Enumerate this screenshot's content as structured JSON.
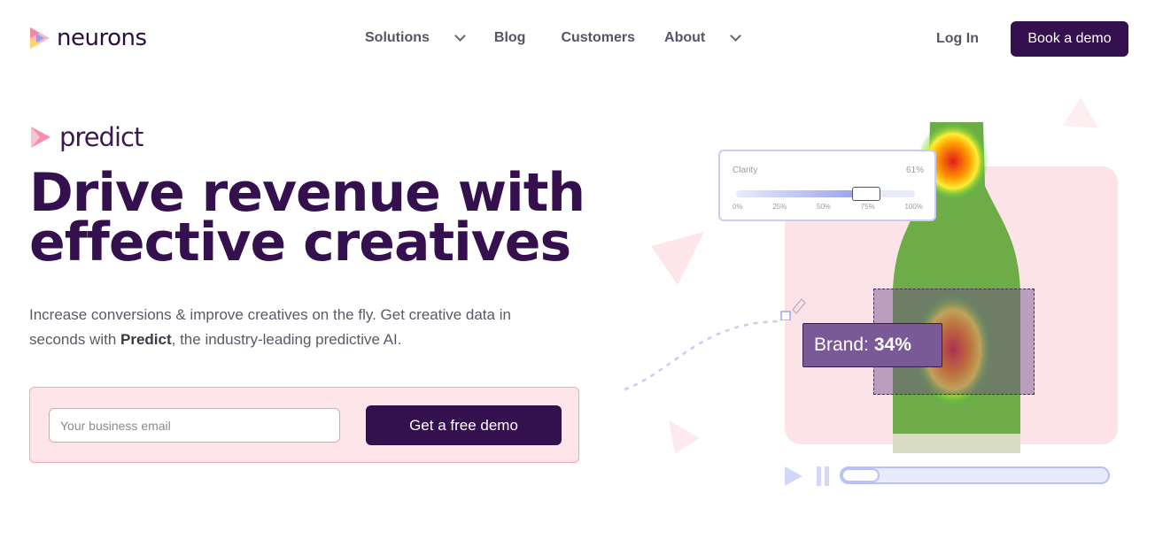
{
  "nav": {
    "logo_text": "neurons",
    "items": [
      {
        "label": "Solutions",
        "has_dropdown": true
      },
      {
        "label": "Blog",
        "has_dropdown": false
      },
      {
        "label": "Customers",
        "has_dropdown": false
      },
      {
        "label": "About",
        "has_dropdown": true
      }
    ],
    "login_label": "Log In",
    "book_demo_label": "Book a demo"
  },
  "hero": {
    "product_name": "predict",
    "headline_line1": "Drive revenue with",
    "headline_line2": "effective creatives",
    "subtext_before": "Increase conversions & improve creatives on the fly. Get creative data in seconds with ",
    "subtext_bold": "Predict",
    "subtext_after": ", the industry-leading predictive AI.",
    "email_placeholder": "Your business email",
    "cta_label": "Get a free demo"
  },
  "visual": {
    "clarity_label": "Clarity",
    "clarity_value": "61%",
    "clarity_level": 0.61,
    "clarity_ticks": [
      "0%",
      "25%",
      "50%",
      "75%",
      "100%"
    ],
    "brand_label": "Brand:",
    "brand_value": "34%",
    "video_progress": 0.1
  },
  "colors": {
    "brand_dark": "#35104f",
    "pink_bg": "#fde5ea",
    "accent_blue": "#b8c0f4"
  }
}
